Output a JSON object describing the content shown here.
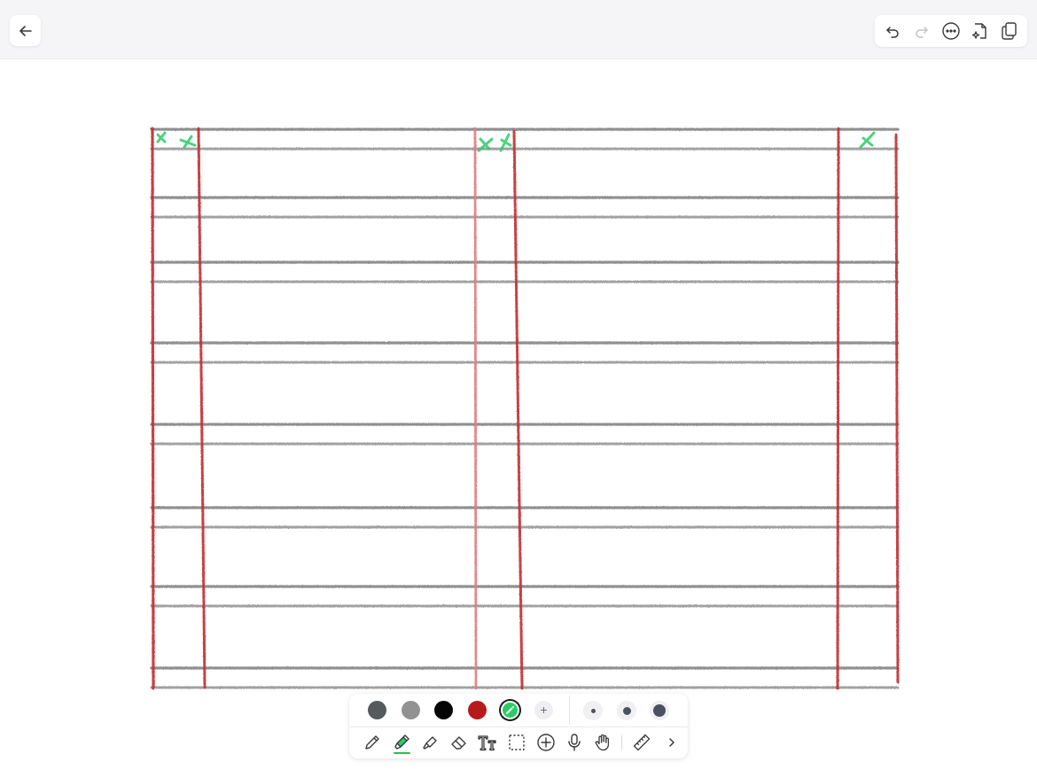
{
  "toolbar": {
    "back": {
      "icon": "arrow-left-icon"
    },
    "right": [
      {
        "name": "undo",
        "icon": "undo-icon",
        "enabled": true
      },
      {
        "name": "redo",
        "icon": "redo-icon",
        "enabled": false
      },
      {
        "name": "more",
        "icon": "more-horizontal-icon",
        "enabled": true
      },
      {
        "name": "ai-page",
        "icon": "page-sparkle-icon",
        "enabled": true
      },
      {
        "name": "pages",
        "icon": "pages-copy-icon",
        "enabled": true
      }
    ]
  },
  "palette": {
    "colors": [
      {
        "name": "dark-gray",
        "hex": "#555b5c"
      },
      {
        "name": "gray",
        "hex": "#929292"
      },
      {
        "name": "black",
        "hex": "#050505"
      },
      {
        "name": "red",
        "hex": "#b81a1a"
      },
      {
        "name": "green",
        "hex": "#2bcc68",
        "selected": true
      }
    ],
    "add_color_label": "+",
    "sizes": [
      "small",
      "medium",
      "large"
    ],
    "tools": [
      {
        "name": "pen",
        "icon": "pen-icon"
      },
      {
        "name": "highlighter",
        "icon": "highlighter-icon",
        "active": true
      },
      {
        "name": "marker",
        "icon": "marker-icon"
      },
      {
        "name": "eraser",
        "icon": "eraser-icon"
      },
      {
        "name": "text",
        "icon": "text-tool-icon",
        "label": "Tt"
      },
      {
        "name": "lasso",
        "icon": "lasso-select-icon"
      },
      {
        "name": "insert",
        "icon": "plus-circle-icon"
      },
      {
        "name": "voice",
        "icon": "microphone-icon"
      },
      {
        "name": "hand",
        "icon": "hand-icon"
      },
      {
        "name": "ruler",
        "icon": "ruler-icon"
      },
      {
        "name": "expand",
        "icon": "chevron-right-icon"
      }
    ]
  },
  "drawing": {
    "grid_line_color": "#8a8a8a",
    "margin_line_color": "#c42f33",
    "light_margin_color": "#e07e80",
    "mark_color": "#2bcc68"
  }
}
